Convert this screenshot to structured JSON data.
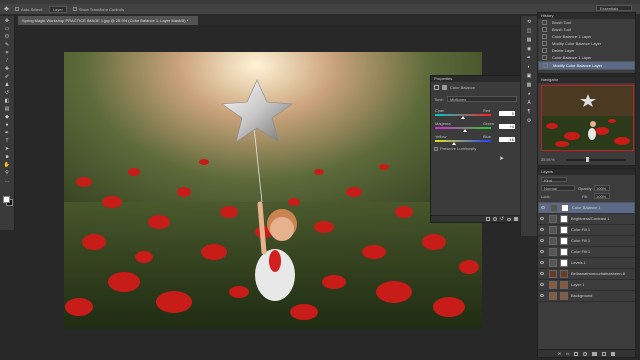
{
  "menubar": {
    "label": ""
  },
  "options": {
    "auto_select": "Auto-Select:",
    "auto_select_value": "Layer",
    "show_transform": "Show Transform Controls"
  },
  "workspace": {
    "label": "Essentials"
  },
  "document": {
    "tab_title": "Spring Magic Workshop PRACTICE IMAGE 1.jpg @ 25.9% (Color Balance 1, Layer Mask/8) *"
  },
  "tools": [
    "move",
    "marquee",
    "lasso",
    "quick-select",
    "crop",
    "eyedropper",
    "heal",
    "brush",
    "stamp",
    "history",
    "eraser",
    "gradient",
    "blur",
    "dodge",
    "pen",
    "type",
    "path-select",
    "shape",
    "hand",
    "zoom"
  ],
  "history": {
    "tab": "History",
    "items": [
      {
        "label": "Brush Tool",
        "selected": false
      },
      {
        "label": "Brush Tool",
        "selected": false
      },
      {
        "label": "Color Balance 1 Layer",
        "selected": false
      },
      {
        "label": "Modify Color Balance Layer",
        "selected": false
      },
      {
        "label": "Delete Layer",
        "selected": false
      },
      {
        "label": "Color Balance 1 Layer",
        "selected": false
      },
      {
        "label": "Modify Color Balance Layer",
        "selected": true
      }
    ]
  },
  "navigator": {
    "tab": "Navigator",
    "zoom": "25.91%"
  },
  "layers": {
    "tab": "Layers",
    "kind": "Kind",
    "blend": "Normal",
    "opacity_label": "Opacity:",
    "opacity": "100%",
    "lock_label": "Lock:",
    "fill_label": "Fill:",
    "fill": "100%",
    "items": [
      {
        "name": "Color Balance 1",
        "selected": true,
        "thumb": "#ffffff"
      },
      {
        "name": "Brightness/Contrast 1",
        "selected": false,
        "thumb": "#ffffff"
      },
      {
        "name": "Color Fill 1",
        "selected": false,
        "thumb": "#ffffff"
      },
      {
        "name": "Color Fill 1",
        "selected": false,
        "thumb": "#ffffff"
      },
      {
        "name": "Color Fill 1",
        "selected": false,
        "thumb": "#ffffff"
      },
      {
        "name": "Levels 1",
        "selected": false,
        "thumb": "#ffffff"
      },
      {
        "name": "Bellasnatmoncurltathasbeen-8",
        "selected": false,
        "thumb": "#6a3a2a"
      },
      {
        "name": "Layer 1",
        "selected": false,
        "thumb": "#8a5a3a"
      },
      {
        "name": "Background",
        "selected": false,
        "thumb": "#8a5a3a"
      }
    ]
  },
  "properties": {
    "tab": "Properties",
    "title": "Color Balance",
    "tone_label": "Tone:",
    "tone": "Midtones",
    "sliders": [
      {
        "left": "Cyan",
        "right": "Red",
        "value": "0",
        "pos": 0.5,
        "gradient": "linear-gradient(90deg,#00c8c8,#ff2020)"
      },
      {
        "left": "Magenta",
        "right": "Green",
        "value": "+4",
        "pos": 0.54,
        "gradient": "linear-gradient(90deg,#e020e0,#20d020)"
      },
      {
        "left": "Yellow",
        "right": "Blue",
        "value": "-16",
        "pos": 0.34,
        "gradient": "linear-gradient(90deg,#e0e020,#2040ff)"
      }
    ],
    "preserve": "Preserve Luminosity"
  },
  "colors": {
    "accent": "#5b6a86",
    "panel": "#3c3c3c",
    "bg": "#282828"
  }
}
